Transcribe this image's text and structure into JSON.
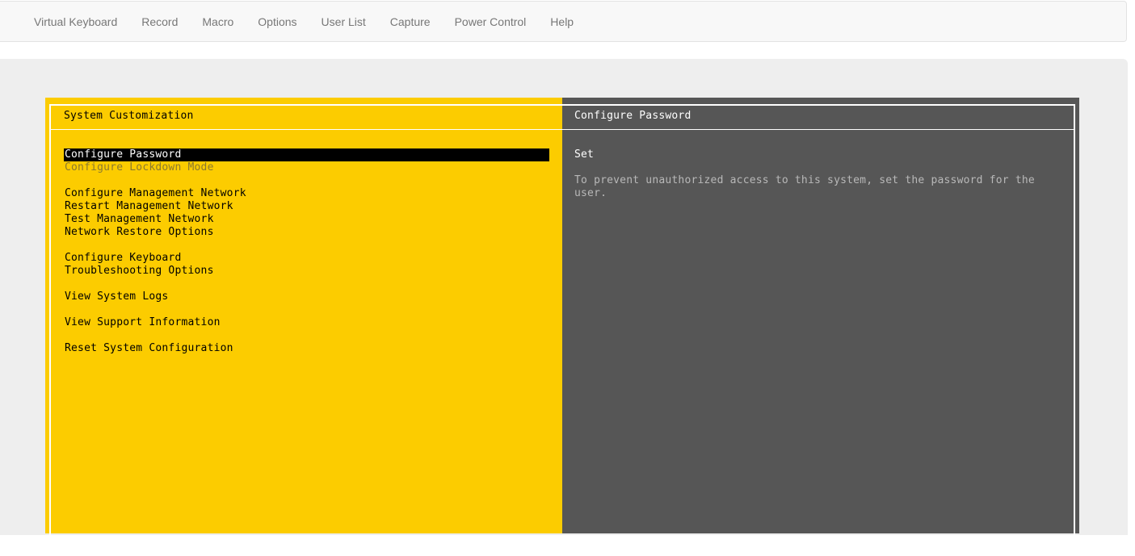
{
  "nav": {
    "items": [
      {
        "label": "Virtual Keyboard",
        "name": "nav-virtual-keyboard"
      },
      {
        "label": "Record",
        "name": "nav-record"
      },
      {
        "label": "Macro",
        "name": "nav-macro"
      },
      {
        "label": "Options",
        "name": "nav-options"
      },
      {
        "label": "User List",
        "name": "nav-user-list"
      },
      {
        "label": "Capture",
        "name": "nav-capture"
      },
      {
        "label": "Power Control",
        "name": "nav-power-control"
      },
      {
        "label": "Help",
        "name": "nav-help"
      }
    ]
  },
  "console": {
    "left_title": "System Customization",
    "right_title": "Configure Password",
    "menu_groups": [
      [
        {
          "label": "Configure Password",
          "selected": true,
          "disabled": false
        },
        {
          "label": "Configure Lockdown Mode",
          "selected": false,
          "disabled": true
        }
      ],
      [
        {
          "label": "Configure Management Network",
          "selected": false,
          "disabled": false
        },
        {
          "label": "Restart Management Network",
          "selected": false,
          "disabled": false
        },
        {
          "label": "Test Management Network",
          "selected": false,
          "disabled": false
        },
        {
          "label": "Network Restore Options",
          "selected": false,
          "disabled": false
        }
      ],
      [
        {
          "label": "Configure Keyboard",
          "selected": false,
          "disabled": false
        },
        {
          "label": "Troubleshooting Options",
          "selected": false,
          "disabled": false
        }
      ],
      [
        {
          "label": "View System Logs",
          "selected": false,
          "disabled": false
        }
      ],
      [
        {
          "label": "View Support Information",
          "selected": false,
          "disabled": false
        }
      ],
      [
        {
          "label": "Reset System Configuration",
          "selected": false,
          "disabled": false
        }
      ]
    ],
    "detail": {
      "status": "Set",
      "description": "To prevent unauthorized access to this system, set the password for the user."
    },
    "colors": {
      "left_background": "#fccc00",
      "right_background": "#565656",
      "selection_background": "#000000"
    }
  }
}
